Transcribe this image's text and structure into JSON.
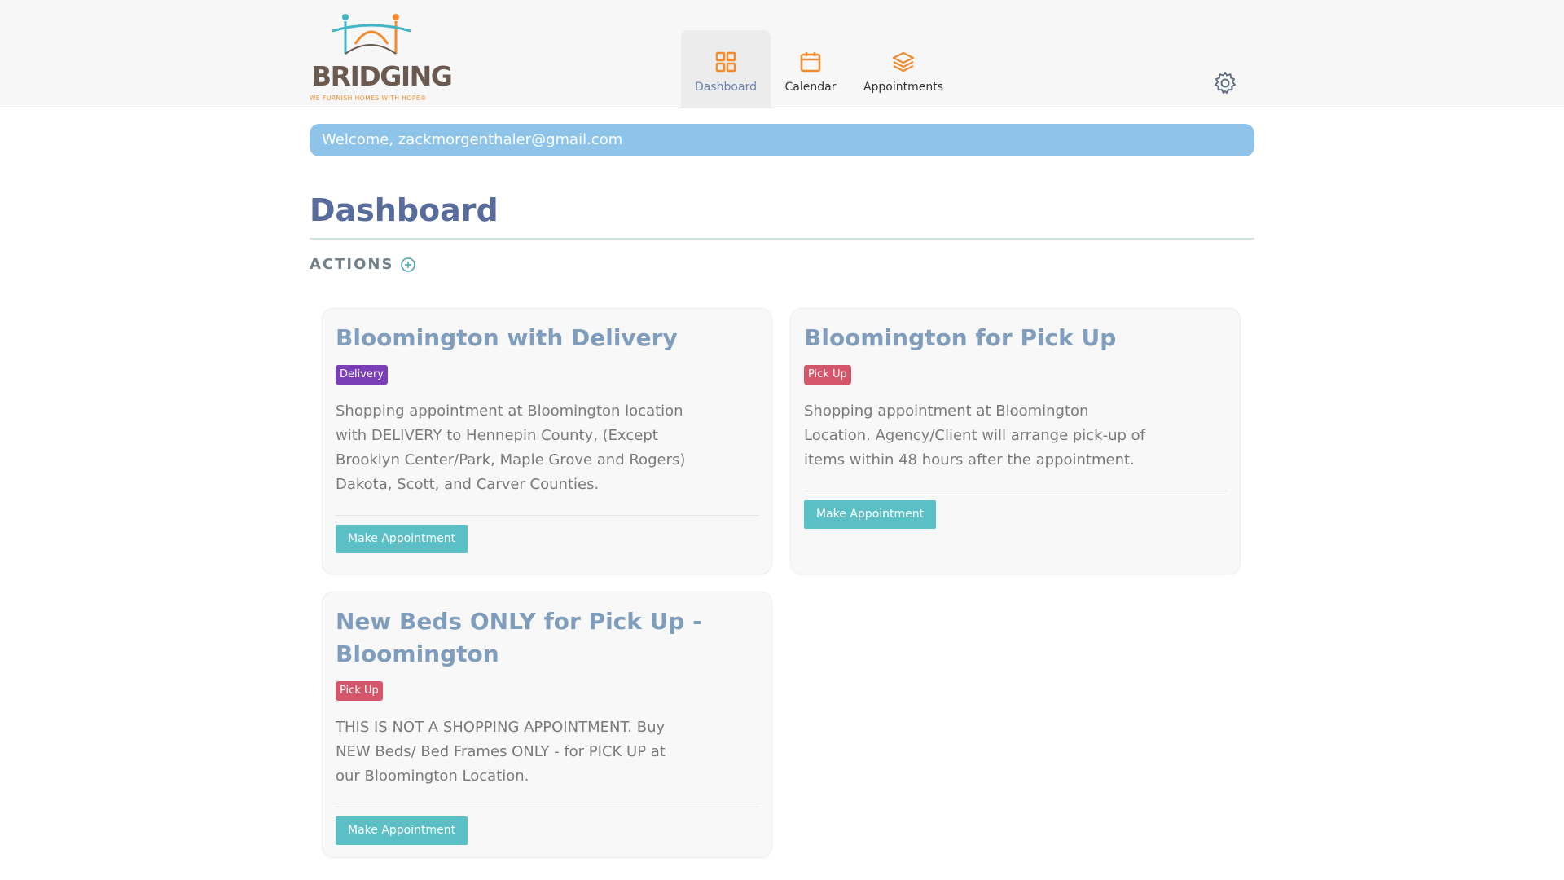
{
  "brand": {
    "name": "BRIDGING",
    "tagline": "WE FURNISH HOMES WITH HOPE®",
    "colors": {
      "teal": "#42b6c6",
      "orange": "#f28a2e",
      "brown": "#6b5a50"
    }
  },
  "nav": {
    "items": [
      {
        "label": "Dashboard",
        "icon": "dashboard-grid-icon",
        "active": true
      },
      {
        "label": "Calendar",
        "icon": "calendar-icon",
        "active": false
      },
      {
        "label": "Appointments",
        "icon": "layers-icon",
        "active": false
      }
    ],
    "settings_icon": "gear-icon"
  },
  "welcome": "Welcome, zackmorgenthaler@gmail.com",
  "page": {
    "title": "Dashboard",
    "actions_label": "ACTIONS"
  },
  "cards": [
    {
      "title": "Bloomington with Delivery",
      "badge": "Delivery",
      "description": "Shopping appointment at Bloomington location with DELIVERY to Hennepin County, (Except Brooklyn Center/Park, Maple Grove and Rogers) Dakota, Scott, and Carver Counties.",
      "button": "Make Appointment"
    },
    {
      "title": "Bloomington for Pick Up",
      "badge": "Pick Up",
      "description": "Shopping appointment at Bloomington Location. Agency/Client will arrange pick-up of items within 48 hours after the appointment.",
      "button": "Make Appointment"
    },
    {
      "title": "New Beds ONLY for Pick Up - Bloomington",
      "badge": "Pick Up",
      "description": "THIS IS NOT A SHOPPING APPOINTMENT. Buy NEW Beds/ Bed Frames ONLY - for PICK UP at our Bloomington Location.",
      "button": "Make Appointment"
    }
  ],
  "colors": {
    "accent": "#5bbfc6",
    "title": "#576b9c",
    "welcome_bg": "#8ec4e9",
    "delivery": "#7a3fb6",
    "pickup": "#d4566b"
  }
}
